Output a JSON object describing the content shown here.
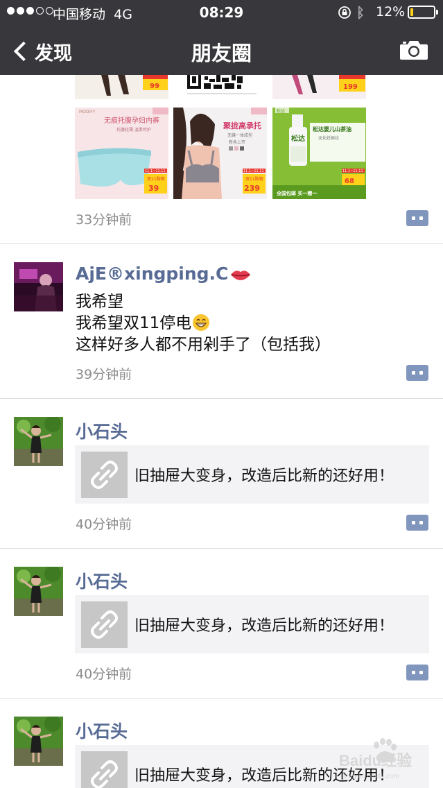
{
  "status_bar": {
    "carrier": "中国移动",
    "network": "4G",
    "time": "08:29",
    "battery_percent": "12%",
    "battery_level": 0.12,
    "battery_color": "#ffd21a",
    "icons": [
      "signal-dots-icon",
      "orientation-lock-icon",
      "bluetooth-icon",
      "battery-icon"
    ]
  },
  "nav": {
    "back_label": "发现",
    "title": "朋友圈",
    "camera_icon": "camera-icon"
  },
  "colors": {
    "nav_bg": "#38383c",
    "name_color": "#576b95",
    "time_color": "#8c8c8c",
    "comment_btn": "#8196bd",
    "link_card_bg": "#f3f3f5"
  },
  "posts": [
    {
      "type": "images",
      "image_badges": [
        "99",
        "199",
        "39",
        "239",
        "68"
      ],
      "image_texts": [
        "无痕托腹孕妇内裤",
        "聚拢高承托",
        "松达婴儿山茶油",
        "松达",
        "全国包邮 买一赠一",
        "双11购物"
      ],
      "time": "33分钟前"
    },
    {
      "type": "text",
      "name": "AjE®xingping.C",
      "lines": [
        "我希望",
        "我希望双11停电",
        "这样好多人都不用剁手了（包括我）"
      ],
      "time": "39分钟前"
    },
    {
      "type": "link",
      "name": "小石头",
      "link_title": "旧抽屉大变身，改造后比新的还好用！",
      "time": "40分钟前"
    },
    {
      "type": "link",
      "name": "小石头",
      "link_title": "旧抽屉大变身，改造后比新的还好用！",
      "time": "40分钟前"
    },
    {
      "type": "link",
      "name": "小石头",
      "link_title": "旧抽屉大变身，改造后比新的还好用！"
    }
  ],
  "watermark": {
    "text": "Baidu经验",
    "subtext": "jingyan.baidu.com"
  }
}
